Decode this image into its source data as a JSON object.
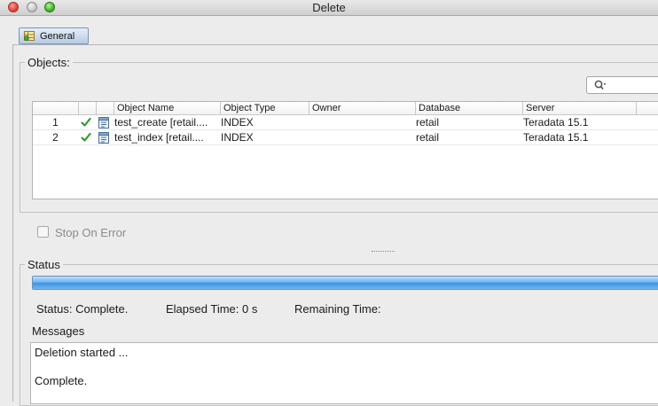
{
  "window": {
    "title": "Delete"
  },
  "tabs": [
    {
      "label": "General",
      "icon": "general-grid-icon",
      "selected": true
    }
  ],
  "objects": {
    "group_title": "Objects:",
    "search": {
      "value": "",
      "icon": "search-icon"
    },
    "columns": [
      "Object Name",
      "Object Type",
      "Owner",
      "Database",
      "Server"
    ],
    "rows": [
      {
        "index": "1",
        "status_icon": "check-icon",
        "object_icon": "index-icon",
        "object_name": "test_create [retail....",
        "object_type": "INDEX",
        "owner": "",
        "database": "retail",
        "server": "Teradata 15.1"
      },
      {
        "index": "2",
        "status_icon": "check-icon",
        "object_icon": "index-icon",
        "object_name": "test_index [retail....",
        "object_type": "INDEX",
        "owner": "",
        "database": "retail",
        "server": "Teradata 15.1"
      }
    ]
  },
  "options": {
    "stop_on_error": {
      "label": "Stop On Error",
      "checked": false,
      "enabled": false
    }
  },
  "status": {
    "group_title": "Status",
    "progress": 1.0,
    "status_text": "Status: Complete.",
    "elapsed_text": "Elapsed Time: 0 s",
    "remaining_text": "Remaining Time:",
    "messages_label": "Messages",
    "messages": [
      "Deletion started ...",
      "",
      "Complete."
    ]
  },
  "colors": {
    "accent": "#3f94e3",
    "check": "#2e9a2e",
    "tab": "#b6cbe4"
  }
}
